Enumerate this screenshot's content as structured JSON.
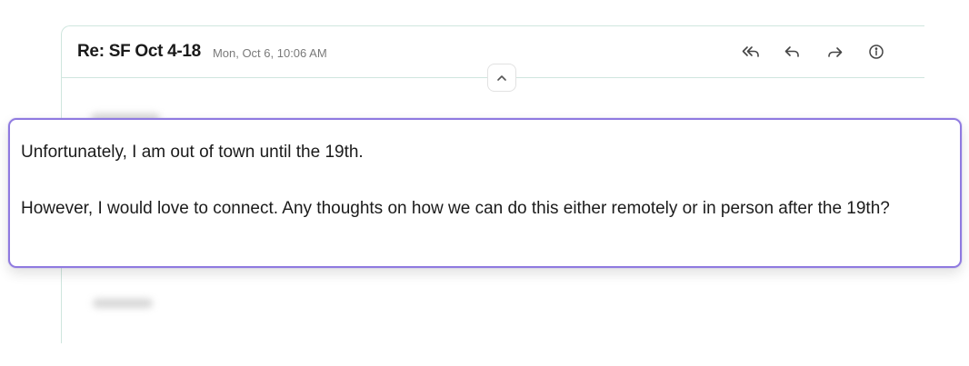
{
  "email": {
    "subject": "Re: SF Oct 4-18",
    "date": "Mon, Oct 6, 10:06 AM",
    "toolbar": {
      "reply_all_icon": "reply-all-icon",
      "reply_icon": "reply-icon",
      "forward_icon": "forward-icon",
      "info_icon": "info-icon"
    },
    "collapse_icon": "chevron-up-icon"
  },
  "focus": {
    "paragraph1": "Unfortunately, I am out of town until the 19th.",
    "paragraph2": "However, I would love to connect. Any thoughts on how we can do this either remotely or in person after the 19th?"
  },
  "colors": {
    "accent_border": "#8f7ae0",
    "card_border": "#cfe6de"
  }
}
